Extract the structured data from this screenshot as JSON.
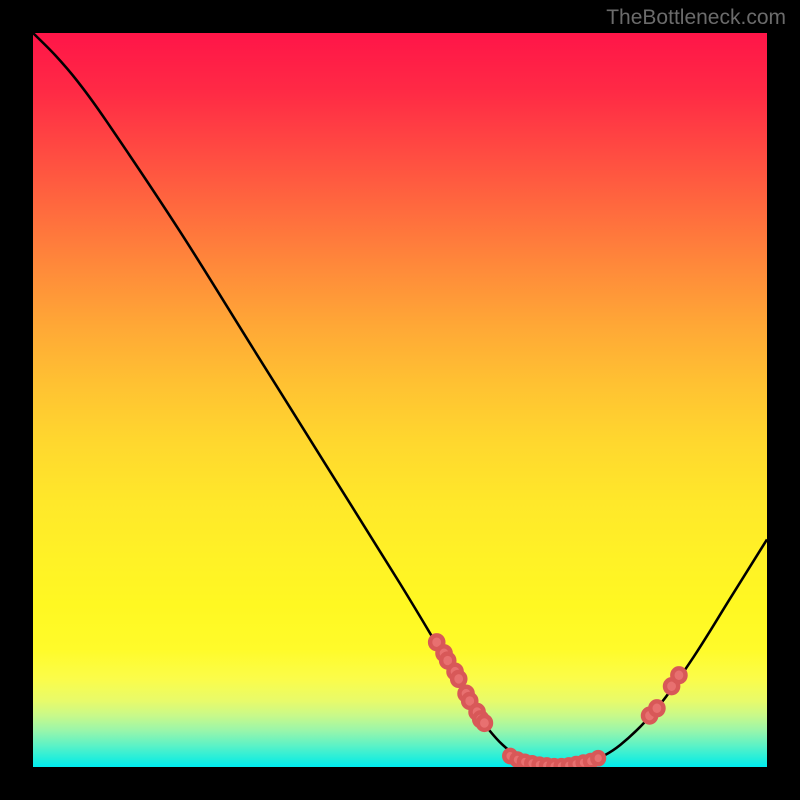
{
  "watermark": "TheBottleneck.com",
  "chart_data": {
    "type": "line",
    "title": "",
    "xlabel": "",
    "ylabel": "",
    "xlim": [
      0,
      100
    ],
    "ylim": [
      0,
      100
    ],
    "curve": [
      {
        "x": 0,
        "y": 100
      },
      {
        "x": 3,
        "y": 97
      },
      {
        "x": 6,
        "y": 93.5
      },
      {
        "x": 10,
        "y": 88
      },
      {
        "x": 20,
        "y": 73
      },
      {
        "x": 30,
        "y": 57
      },
      {
        "x": 40,
        "y": 41
      },
      {
        "x": 50,
        "y": 25
      },
      {
        "x": 56,
        "y": 15
      },
      {
        "x": 60,
        "y": 8
      },
      {
        "x": 64,
        "y": 3
      },
      {
        "x": 68,
        "y": 0.5
      },
      {
        "x": 72,
        "y": 0
      },
      {
        "x": 76,
        "y": 0.8
      },
      {
        "x": 80,
        "y": 3
      },
      {
        "x": 85,
        "y": 8
      },
      {
        "x": 90,
        "y": 15
      },
      {
        "x": 95,
        "y": 23
      },
      {
        "x": 100,
        "y": 31
      }
    ],
    "points_left_cluster": [
      {
        "x": 55,
        "y": 17
      },
      {
        "x": 56,
        "y": 15.5
      },
      {
        "x": 56.5,
        "y": 14.5
      },
      {
        "x": 57.5,
        "y": 13
      },
      {
        "x": 58,
        "y": 12
      },
      {
        "x": 59,
        "y": 10
      },
      {
        "x": 59.5,
        "y": 9
      },
      {
        "x": 60.5,
        "y": 7.5
      },
      {
        "x": 61,
        "y": 6.5
      },
      {
        "x": 61.5,
        "y": 6
      }
    ],
    "points_bottom_cluster": [
      {
        "x": 65,
        "y": 1.5
      },
      {
        "x": 66,
        "y": 1
      },
      {
        "x": 67,
        "y": 0.7
      },
      {
        "x": 68,
        "y": 0.5
      },
      {
        "x": 69,
        "y": 0.3
      },
      {
        "x": 70,
        "y": 0.2
      },
      {
        "x": 71,
        "y": 0.1
      },
      {
        "x": 72,
        "y": 0.1
      },
      {
        "x": 73,
        "y": 0.2
      },
      {
        "x": 74,
        "y": 0.4
      },
      {
        "x": 75,
        "y": 0.6
      },
      {
        "x": 76,
        "y": 0.8
      },
      {
        "x": 77,
        "y": 1.2
      }
    ],
    "points_right_cluster": [
      {
        "x": 84,
        "y": 7
      },
      {
        "x": 85,
        "y": 8
      },
      {
        "x": 87,
        "y": 11
      },
      {
        "x": 88,
        "y": 12.5
      }
    ]
  }
}
